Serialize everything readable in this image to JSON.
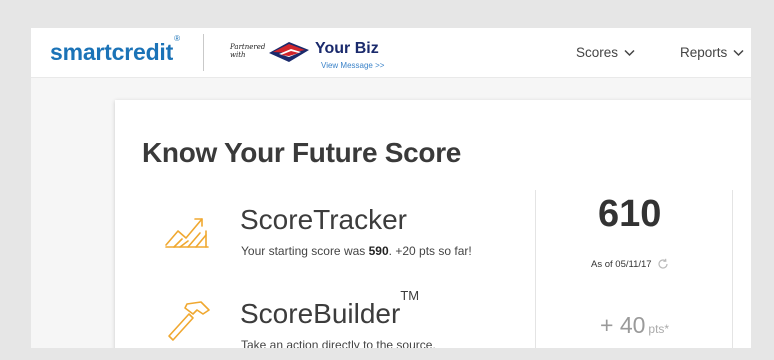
{
  "header": {
    "logo_text": "smartcredit",
    "logo_mark": "®",
    "partner_label_line1": "Partnered",
    "partner_label_line2": "with",
    "partner_name": "Your Biz",
    "view_message": "View Message >>",
    "nav": [
      {
        "label": "Scores",
        "icon": "chevron-down-icon"
      },
      {
        "label": "Reports",
        "icon": "chevron-down-icon"
      }
    ]
  },
  "card": {
    "title": "Know Your Future Score",
    "scoretracker": {
      "title": "ScoreTracker",
      "desc_before": "Your starting score was ",
      "desc_bold": "590",
      "desc_after": ". +20 pts so far!",
      "score": "610",
      "as_of": "As of 05/11/17",
      "icon": "trend-chart-icon"
    },
    "scorebuilder": {
      "title": "ScoreBuilder",
      "tm": "TM",
      "desc": "Take an action directly to the source.",
      "gain": "+ 40",
      "gain_unit": "pts*",
      "icon": "hammer-icon"
    }
  },
  "colors": {
    "brand_blue": "#1b73b7",
    "accent_orange": "#f0a830",
    "partner_navy": "#1a2a6c",
    "partner_red": "#d1252b"
  }
}
